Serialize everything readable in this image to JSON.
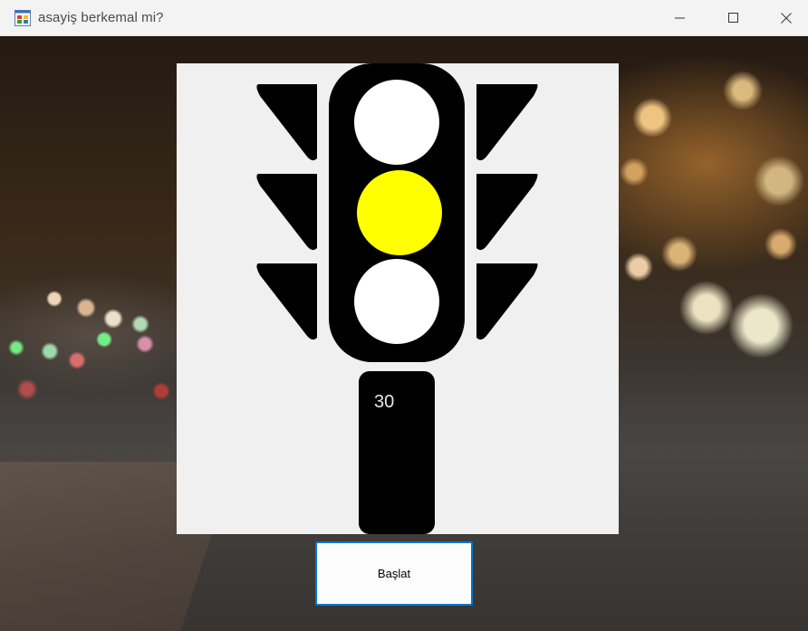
{
  "window": {
    "title": "asayiş berkemal mi?",
    "app_icon": "windows-form-icon",
    "controls": {
      "minimize_icon": "minimize-icon",
      "maximize_icon": "maximize-icon",
      "close_icon": "close-icon"
    }
  },
  "traffic_light": {
    "lamps": [
      {
        "position": "top",
        "color": "#ffffff",
        "lit": false
      },
      {
        "position": "middle",
        "color": "#ffff00",
        "lit": true
      },
      {
        "position": "bottom",
        "color": "#ffffff",
        "lit": false
      }
    ],
    "counter_text": "30",
    "panel_color": "#f0f0f0",
    "body_color": "#000000"
  },
  "start_button": {
    "label": "Başlat",
    "focus_color": "#0078d4"
  }
}
